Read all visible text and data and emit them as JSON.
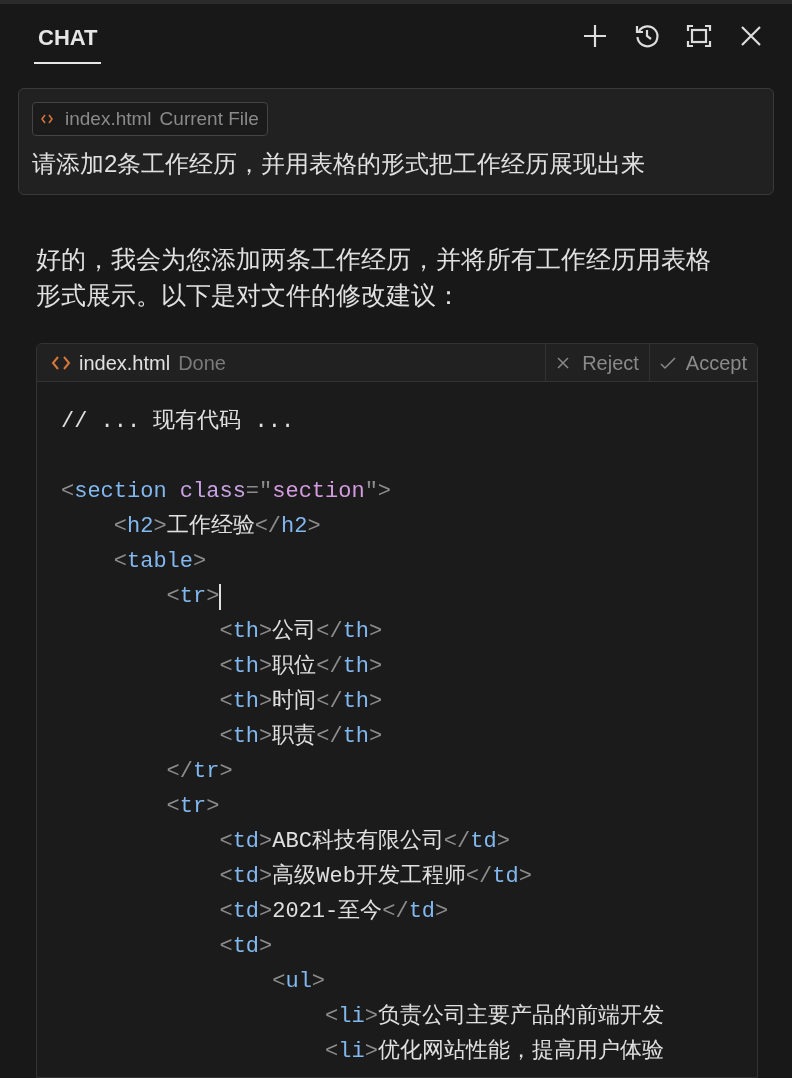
{
  "tabs": [
    {
      "label": "CHAT",
      "selected": true
    }
  ],
  "prompt": {
    "file_chip": {
      "name": "index.html",
      "note": "Current File"
    },
    "text": "请添加2条工作经历，并用表格的形式把工作经历展现出来"
  },
  "reply": "好的，我会为您添加两条工作经历，并将所有工作经历用表格形式展示。以下是对文件的修改建议：",
  "code_block": {
    "file": "index.html",
    "status": "Done",
    "actions": [
      {
        "kind": "reject",
        "label": "Reject"
      },
      {
        "kind": "accept",
        "label": "Accept"
      }
    ],
    "lines": [
      {
        "tokens": [
          {
            "kind": "comment",
            "text": "// ... 现有代码 ..."
          }
        ]
      },
      {
        "tokens": [
          {
            "kind": "punct",
            "text": "<"
          },
          {
            "kind": "tag",
            "text": "section"
          },
          {
            "kind": "attr",
            "text": " class"
          },
          {
            "kind": "punct",
            "text": "="
          },
          {
            "kind": "punct",
            "text": "\""
          },
          {
            "kind": "string",
            "text": "section"
          },
          {
            "kind": "punct",
            "text": "\">"
          }
        ]
      },
      {
        "tokens": [
          {
            "kind": "punct",
            "text": "    <"
          },
          {
            "kind": "tag",
            "text": "h2"
          },
          {
            "kind": "punct",
            "text": ">"
          },
          {
            "kind": "text",
            "text": "工作经验"
          },
          {
            "kind": "punct",
            "text": "</"
          },
          {
            "kind": "tag",
            "text": "h2"
          },
          {
            "kind": "punct",
            "text": ">"
          }
        ]
      },
      {
        "tokens": [
          {
            "kind": "punct",
            "text": "    <"
          },
          {
            "kind": "tag",
            "text": "table"
          },
          {
            "kind": "punct",
            "text": ">"
          }
        ]
      },
      {
        "cursor": true,
        "tokens": [
          {
            "kind": "punct",
            "text": "        <"
          },
          {
            "kind": "tag",
            "text": "tr"
          },
          {
            "kind": "punct",
            "text": ">"
          }
        ]
      },
      {
        "tokens": [
          {
            "kind": "punct",
            "text": "            <"
          },
          {
            "kind": "tag",
            "text": "th"
          },
          {
            "kind": "punct",
            "text": ">"
          },
          {
            "kind": "text",
            "text": "公司"
          },
          {
            "kind": "punct",
            "text": "</"
          },
          {
            "kind": "tag",
            "text": "th"
          },
          {
            "kind": "punct",
            "text": ">"
          }
        ]
      },
      {
        "tokens": [
          {
            "kind": "punct",
            "text": "            <"
          },
          {
            "kind": "tag",
            "text": "th"
          },
          {
            "kind": "punct",
            "text": ">"
          },
          {
            "kind": "text",
            "text": "职位"
          },
          {
            "kind": "punct",
            "text": "</"
          },
          {
            "kind": "tag",
            "text": "th"
          },
          {
            "kind": "punct",
            "text": ">"
          }
        ]
      },
      {
        "tokens": [
          {
            "kind": "punct",
            "text": "            <"
          },
          {
            "kind": "tag",
            "text": "th"
          },
          {
            "kind": "punct",
            "text": ">"
          },
          {
            "kind": "text",
            "text": "时间"
          },
          {
            "kind": "punct",
            "text": "</"
          },
          {
            "kind": "tag",
            "text": "th"
          },
          {
            "kind": "punct",
            "text": ">"
          }
        ]
      },
      {
        "tokens": [
          {
            "kind": "punct",
            "text": "            <"
          },
          {
            "kind": "tag",
            "text": "th"
          },
          {
            "kind": "punct",
            "text": ">"
          },
          {
            "kind": "text",
            "text": "职责"
          },
          {
            "kind": "punct",
            "text": "</"
          },
          {
            "kind": "tag",
            "text": "th"
          },
          {
            "kind": "punct",
            "text": ">"
          }
        ]
      },
      {
        "tokens": [
          {
            "kind": "punct",
            "text": "        </"
          },
          {
            "kind": "tag",
            "text": "tr"
          },
          {
            "kind": "punct",
            "text": ">"
          }
        ]
      },
      {
        "tokens": [
          {
            "kind": "punct",
            "text": "        <"
          },
          {
            "kind": "tag",
            "text": "tr"
          },
          {
            "kind": "punct",
            "text": ">"
          }
        ]
      },
      {
        "tokens": [
          {
            "kind": "punct",
            "text": "            <"
          },
          {
            "kind": "tag",
            "text": "td"
          },
          {
            "kind": "punct",
            "text": ">"
          },
          {
            "kind": "text",
            "text": "ABC科技有限公司"
          },
          {
            "kind": "punct",
            "text": "</"
          },
          {
            "kind": "tag",
            "text": "td"
          },
          {
            "kind": "punct",
            "text": ">"
          }
        ]
      },
      {
        "tokens": [
          {
            "kind": "punct",
            "text": "            <"
          },
          {
            "kind": "tag",
            "text": "td"
          },
          {
            "kind": "punct",
            "text": ">"
          },
          {
            "kind": "text",
            "text": "高级Web开发工程师"
          },
          {
            "kind": "punct",
            "text": "</"
          },
          {
            "kind": "tag",
            "text": "td"
          },
          {
            "kind": "punct",
            "text": ">"
          }
        ]
      },
      {
        "tokens": [
          {
            "kind": "punct",
            "text": "            <"
          },
          {
            "kind": "tag",
            "text": "td"
          },
          {
            "kind": "punct",
            "text": ">"
          },
          {
            "kind": "text",
            "text": "2021-至今"
          },
          {
            "kind": "punct",
            "text": "</"
          },
          {
            "kind": "tag",
            "text": "td"
          },
          {
            "kind": "punct",
            "text": ">"
          }
        ]
      },
      {
        "tokens": [
          {
            "kind": "punct",
            "text": "            <"
          },
          {
            "kind": "tag",
            "text": "td"
          },
          {
            "kind": "punct",
            "text": ">"
          }
        ]
      },
      {
        "tokens": [
          {
            "kind": "punct",
            "text": "                <"
          },
          {
            "kind": "tag",
            "text": "ul"
          },
          {
            "kind": "punct",
            "text": ">"
          }
        ]
      },
      {
        "tokens": [
          {
            "kind": "punct",
            "text": "                    <"
          },
          {
            "kind": "tag",
            "text": "li"
          },
          {
            "kind": "punct",
            "text": ">"
          },
          {
            "kind": "text",
            "text": "负责公司主要产品的前端开发"
          }
        ]
      },
      {
        "tokens": [
          {
            "kind": "punct",
            "text": "                    <"
          },
          {
            "kind": "tag",
            "text": "li"
          },
          {
            "kind": "punct",
            "text": ">"
          },
          {
            "kind": "text",
            "text": "优化网站性能，提高用户体验"
          }
        ]
      }
    ]
  }
}
